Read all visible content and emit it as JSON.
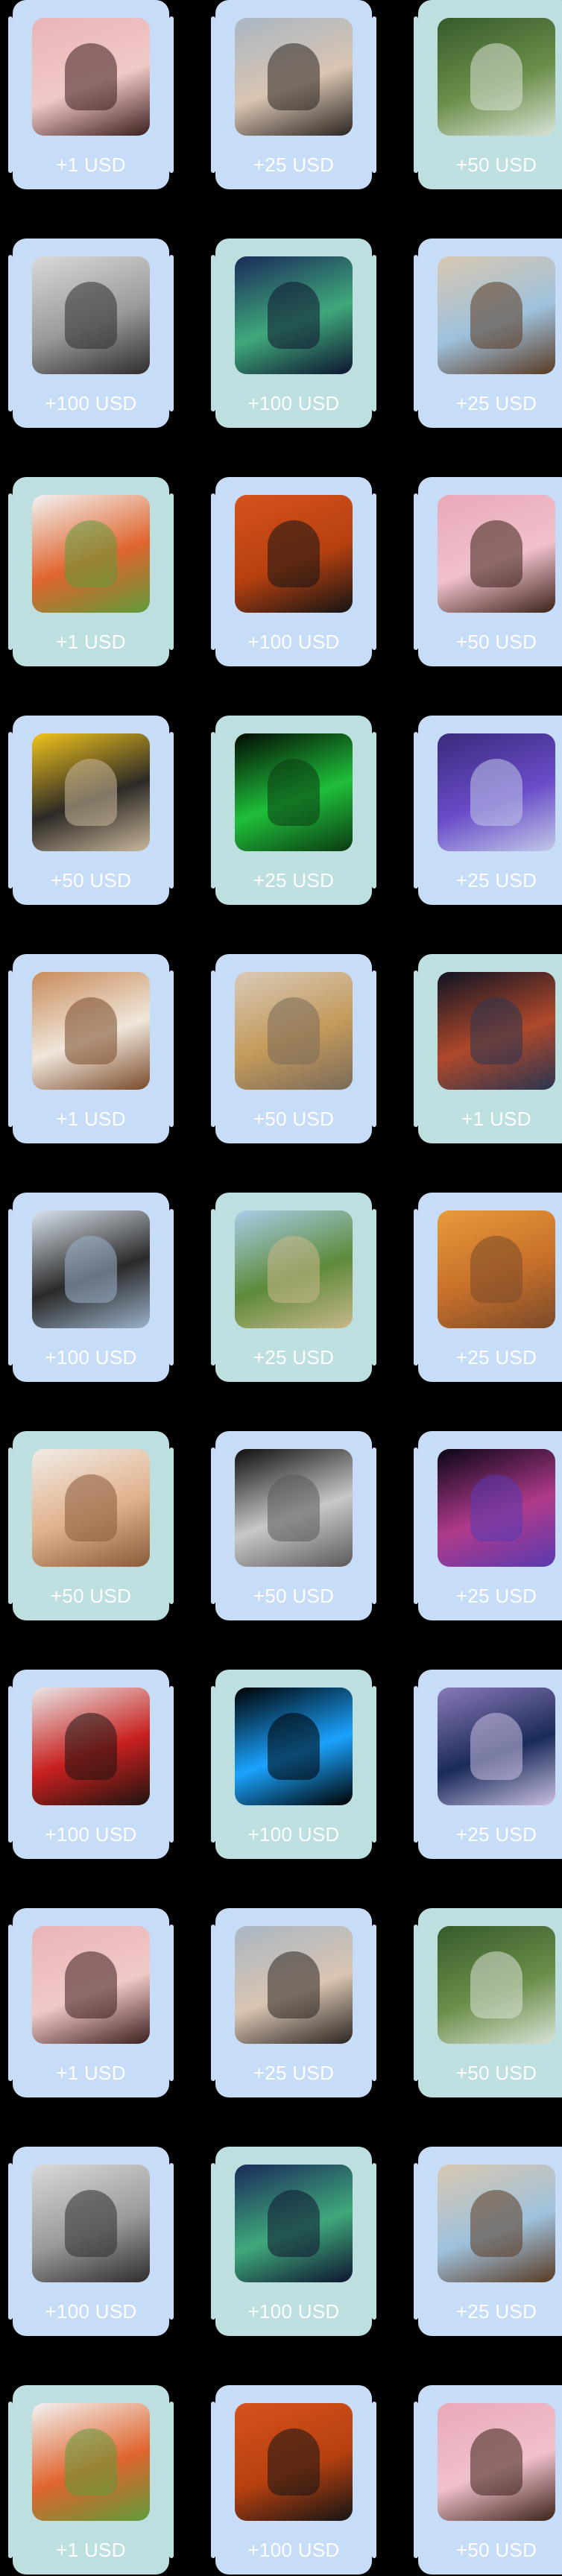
{
  "cards": [
    {
      "reward": "+1 USD",
      "image": "woman-portrait-pink",
      "theme": "blue",
      "colors": [
        "#e8b4b8",
        "#f1c9c6",
        "#3a1e1e"
      ]
    },
    {
      "reward": "+25 USD",
      "image": "woman-sunglasses-excited",
      "theme": "blue",
      "colors": [
        "#a9b7c3",
        "#d9c4b2",
        "#2b2420"
      ]
    },
    {
      "reward": "+50 USD",
      "image": "waterfall-forest",
      "theme": "green",
      "colors": [
        "#355b2b",
        "#6c8f4a",
        "#d8e2d6"
      ]
    },
    {
      "reward": "+100 USD",
      "image": "man-smiling-bw",
      "theme": "blue",
      "colors": [
        "#d9d9d9",
        "#9a9a9a",
        "#2d2d2d"
      ]
    },
    {
      "reward": "+100 USD",
      "image": "aurora-mountain-lake",
      "theme": "green",
      "colors": [
        "#1a2a5a",
        "#3fa97b",
        "#0e1430"
      ]
    },
    {
      "reward": "+25 USD",
      "image": "man-sitting-circle-window",
      "theme": "blue",
      "colors": [
        "#d8c7b0",
        "#9fc1dc",
        "#5a3a22"
      ]
    },
    {
      "reward": "+1 USD",
      "image": "salad-bowl",
      "theme": "green",
      "colors": [
        "#f2f2f2",
        "#e0652e",
        "#5f9b3a"
      ]
    },
    {
      "reward": "+100 USD",
      "image": "man-silhouette-orange",
      "theme": "blue",
      "colors": [
        "#d4531c",
        "#b8400f",
        "#141414"
      ]
    },
    {
      "reward": "+50 USD",
      "image": "girl-curly-hair-pink",
      "theme": "blue",
      "colors": [
        "#e9a8b8",
        "#f1c0cc",
        "#3b2318"
      ]
    },
    {
      "reward": "+50 USD",
      "image": "pug-yellow",
      "theme": "blue",
      "colors": [
        "#f1c31c",
        "#2d2a26",
        "#c9b69a"
      ]
    },
    {
      "reward": "+25 USD",
      "image": "matrix-code",
      "theme": "green",
      "colors": [
        "#040a04",
        "#1fbf3a",
        "#0b3a12"
      ]
    },
    {
      "reward": "+25 USD",
      "image": "vr-gamer-neon",
      "theme": "blue",
      "colors": [
        "#3a2a7a",
        "#6a4bc9",
        "#c0c8e8"
      ]
    },
    {
      "reward": "+1 USD",
      "image": "people-dinner-table",
      "theme": "blue",
      "colors": [
        "#c98b5a",
        "#efe6da",
        "#7a4a2a"
      ]
    },
    {
      "reward": "+50 USD",
      "image": "woman-blonde-portrait",
      "theme": "blue",
      "colors": [
        "#d8c9b8",
        "#c39a5a",
        "#7a6a5a"
      ]
    },
    {
      "reward": "+1 USD",
      "image": "planet-space",
      "theme": "green",
      "colors": [
        "#0e1424",
        "#b0482a",
        "#2a3550"
      ]
    },
    {
      "reward": "+100 USD",
      "image": "two-women-sitting",
      "theme": "blue",
      "colors": [
        "#d8e2ec",
        "#2a2a2a",
        "#9ab0c8"
      ]
    },
    {
      "reward": "+25 USD",
      "image": "tree-savanna",
      "theme": "green",
      "colors": [
        "#a8cde8",
        "#5e8a3a",
        "#c8b88a"
      ]
    },
    {
      "reward": "+25 USD",
      "image": "desert-zebras-sunset",
      "theme": "blue",
      "colors": [
        "#e89a3a",
        "#c66f2a",
        "#7a4a2a"
      ]
    },
    {
      "reward": "+50 USD",
      "image": "hamster",
      "theme": "green",
      "colors": [
        "#f0ece6",
        "#e0b08a",
        "#8a5a3a"
      ]
    },
    {
      "reward": "+50 USD",
      "image": "man-bw-portrait-dark",
      "theme": "blue",
      "colors": [
        "#0e0e0e",
        "#c8c8c8",
        "#5a5a5a"
      ]
    },
    {
      "reward": "+25 USD",
      "image": "nebula-pink",
      "theme": "blue",
      "colors": [
        "#0a0616",
        "#b03a8a",
        "#5a3ab0"
      ]
    },
    {
      "reward": "+100 USD",
      "image": "woman-red-wall",
      "theme": "blue",
      "colors": [
        "#e8e6e6",
        "#c8201e",
        "#1e1410"
      ]
    },
    {
      "reward": "+100 USD",
      "image": "avatar-placeholder",
      "theme": "green",
      "colors": [
        "#000000",
        "#1aa3ff",
        "#000000"
      ]
    },
    {
      "reward": "+25 USD",
      "image": "vr-man-purple",
      "theme": "blue",
      "colors": [
        "#8a7ab8",
        "#1a2a5a",
        "#c8c0e0"
      ]
    },
    {
      "reward": "+1 USD",
      "image": "woman-portrait-pink",
      "theme": "blue",
      "colors": [
        "#e8b4b8",
        "#f1c9c6",
        "#3a1e1e"
      ]
    },
    {
      "reward": "+25 USD",
      "image": "woman-sunglasses-excited",
      "theme": "blue",
      "colors": [
        "#a9b7c3",
        "#d9c4b2",
        "#2b2420"
      ]
    },
    {
      "reward": "+50 USD",
      "image": "waterfall-forest",
      "theme": "green",
      "colors": [
        "#355b2b",
        "#6c8f4a",
        "#d8e2d6"
      ]
    },
    {
      "reward": "+100 USD",
      "image": "man-smiling-bw",
      "theme": "blue",
      "colors": [
        "#d9d9d9",
        "#9a9a9a",
        "#2d2d2d"
      ]
    },
    {
      "reward": "+100 USD",
      "image": "aurora-mountain-lake",
      "theme": "green",
      "colors": [
        "#1a2a5a",
        "#3fa97b",
        "#0e1430"
      ]
    },
    {
      "reward": "+25 USD",
      "image": "man-sitting-circle-window",
      "theme": "blue",
      "colors": [
        "#d8c7b0",
        "#9fc1dc",
        "#5a3a22"
      ]
    },
    {
      "reward": "+1 USD",
      "image": "salad-bowl",
      "theme": "green",
      "colors": [
        "#f2f2f2",
        "#e0652e",
        "#5f9b3a"
      ]
    },
    {
      "reward": "+100 USD",
      "image": "man-silhouette-orange",
      "theme": "blue",
      "colors": [
        "#d4531c",
        "#b8400f",
        "#141414"
      ]
    },
    {
      "reward": "+50 USD",
      "image": "girl-curly-hair-pink",
      "theme": "blue",
      "colors": [
        "#e9a8b8",
        "#f1c0cc",
        "#3b2318"
      ]
    }
  ]
}
